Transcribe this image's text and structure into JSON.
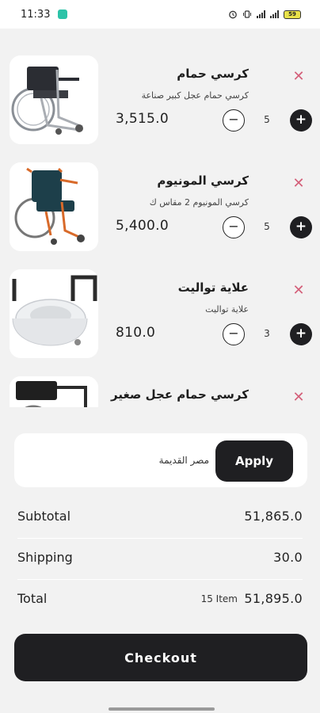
{
  "status_bar": {
    "time": "11:33",
    "battery": "59",
    "icons": [
      "alarm-icon",
      "vibrate-icon",
      "signal-icon",
      "signal-icon",
      "battery-icon"
    ]
  },
  "cart": {
    "items": [
      {
        "name": "كرسي حمام",
        "description": "كرسي حمام عجل كبير صناعة",
        "price": "3,515.0",
        "quantity": "5",
        "image": "wheelchair-commode-image"
      },
      {
        "name": "كرسي المونيوم",
        "description": "كرسي المونيوم 2 مقاس ك",
        "price": "5,400.0",
        "quantity": "5",
        "image": "aluminum-wheelchair-image"
      },
      {
        "name": "علاية تواليت",
        "description": "علاية تواليت",
        "price": "810.0",
        "quantity": "3",
        "image": "toilet-raiser-image"
      },
      {
        "name": "كرسي حمام عجل صغير",
        "description": "",
        "price": "",
        "quantity": "",
        "image": "wheelchair-image"
      }
    ],
    "remove_symbol": "✕",
    "minus_symbol": "−",
    "plus_symbol": "+"
  },
  "coupon": {
    "value": "مصر القديمة",
    "apply_label": "Apply"
  },
  "summary": {
    "subtotal_label": "Subtotal",
    "subtotal_value": "51,865.0",
    "shipping_label": "Shipping",
    "shipping_value": "30.0",
    "total_label": "Total",
    "item_count": "15 Item",
    "total_value": "51,895.0"
  },
  "checkout_label": "Checkout",
  "colors": {
    "accent_dark": "#1f1f22",
    "remove_pink": "#d4607a",
    "background": "#f2f2f2"
  }
}
